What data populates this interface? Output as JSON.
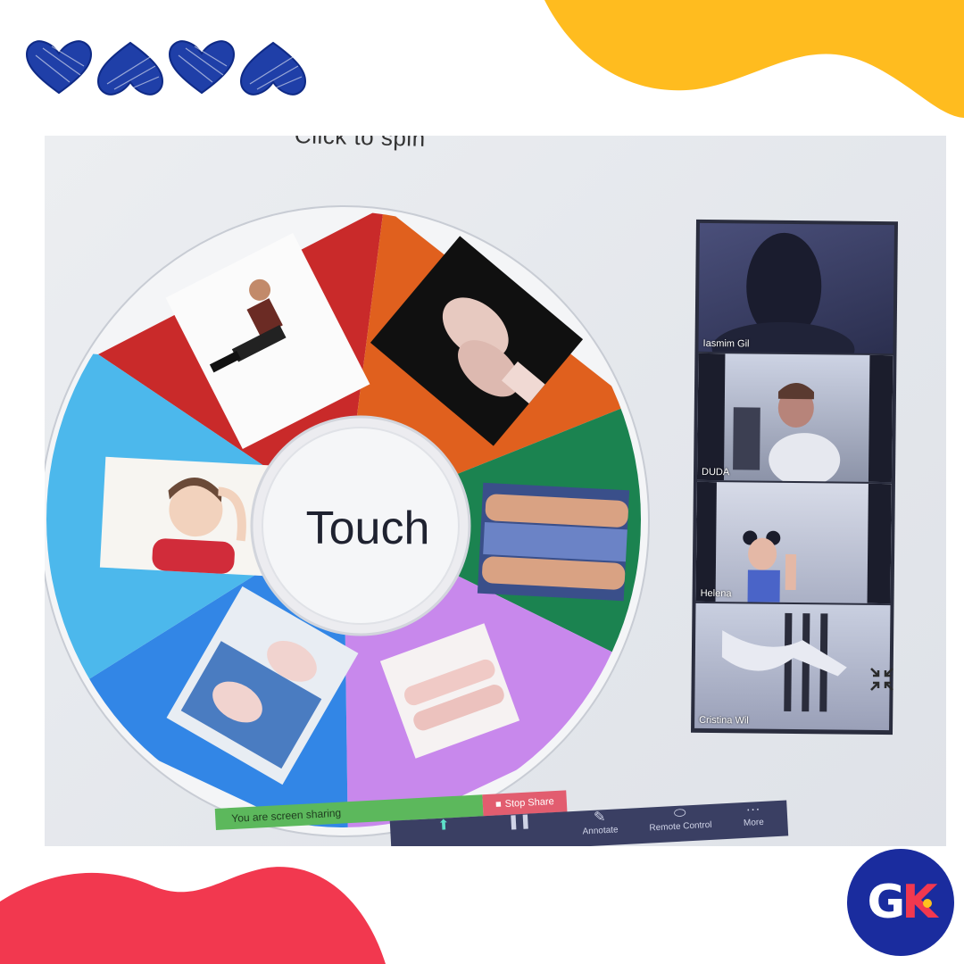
{
  "header": {
    "top_text": "Click to spin"
  },
  "wheel": {
    "center_label": "Touch",
    "segments": [
      {
        "color": "#c92a2a",
        "icon": "child-standing-photo"
      },
      {
        "color": "#e0601e",
        "icon": "hands-photo"
      },
      {
        "color": "#1b8350",
        "icon": "arms-photo"
      },
      {
        "color": "#c888ec",
        "icon": "legs-photo"
      },
      {
        "color": "#3286e6",
        "icon": "feet-photo"
      },
      {
        "color": "#4cb8ec",
        "icon": "head-photo"
      }
    ]
  },
  "participants": [
    {
      "name": "Iasmim Gil"
    },
    {
      "name": "DUDA"
    },
    {
      "name": "Helena"
    },
    {
      "name": "Cristina Wil"
    }
  ],
  "toolbar": {
    "sharing_text": "You are screen sharing",
    "stop_share_label": "Stop Share",
    "annotate_label": "Annotate",
    "remote_control_label": "Remote Control",
    "more_label": "More"
  },
  "brand": {
    "logo_text": "GK",
    "yellow": "#ffbc1f",
    "red": "#f2384f",
    "navy": "#1a2c9e"
  }
}
